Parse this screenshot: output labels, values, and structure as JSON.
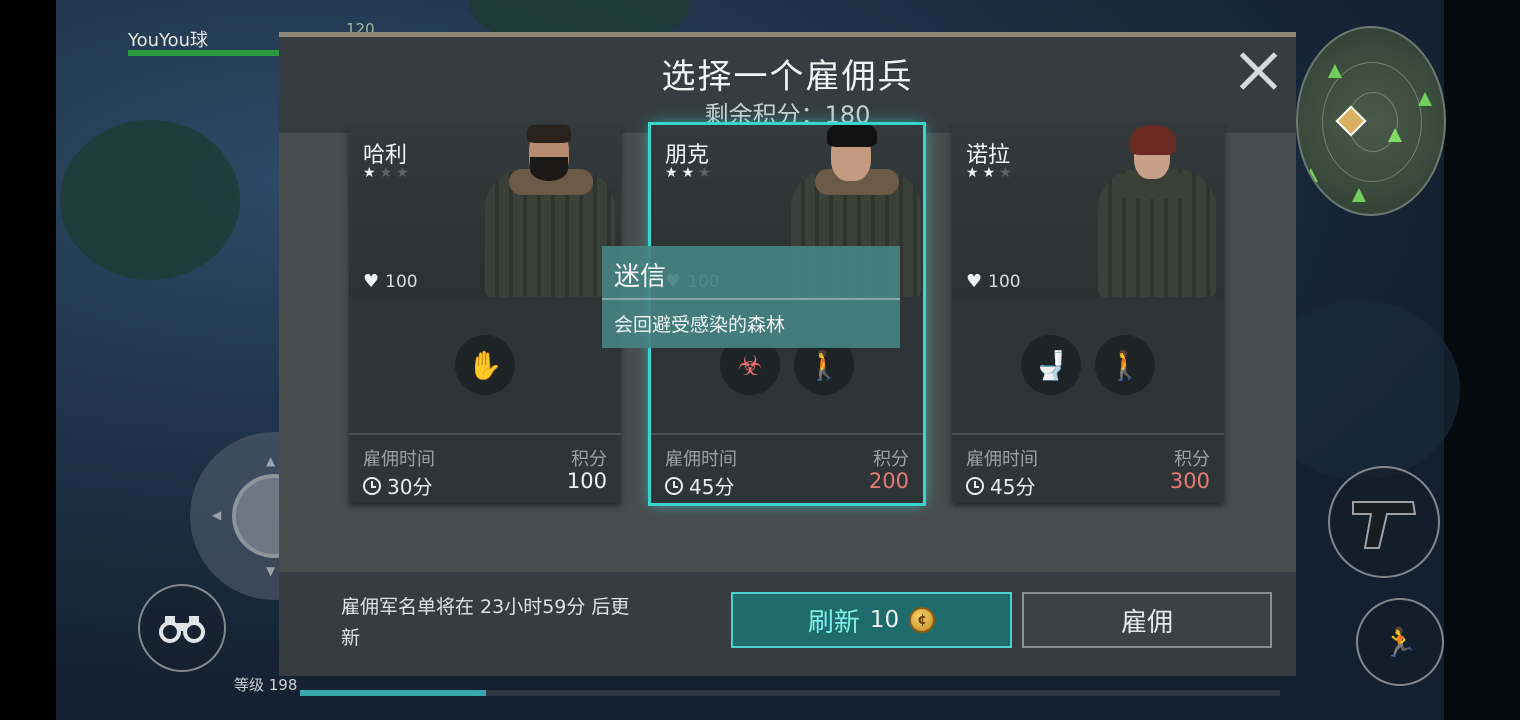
{
  "hud": {
    "player_name": "YouYou球",
    "hp_value": "120",
    "level_label": "等级 198",
    "xp_progress": 0.19
  },
  "modal": {
    "title": "选择一个雇佣兵",
    "points_left": "剩余积分：180",
    "notice": "雇佣军名单将在 23小时59分 后更新",
    "refresh_label": "刷新",
    "refresh_cost": "10",
    "coin_symbol": "¢",
    "hire_label": "雇佣",
    "time_label": "雇佣时间",
    "points_label": "积分"
  },
  "cards": [
    {
      "name": "哈利",
      "stars": 1,
      "hp": "100",
      "traits": [
        {
          "icon": "grab-hand-icon",
          "glyph": "✋",
          "color": "green"
        }
      ],
      "time": "30分",
      "cost": "100",
      "affordable": true,
      "selected": false
    },
    {
      "name": "朋克",
      "stars": 2,
      "hp": "100",
      "traits": [
        {
          "icon": "infected-head-icon",
          "glyph": "☣",
          "color": "red"
        },
        {
          "icon": "walking-person-icon",
          "glyph": "🚶",
          "color": "green"
        }
      ],
      "time": "45分",
      "cost": "200",
      "affordable": false,
      "selected": true
    },
    {
      "name": "诺拉",
      "stars": 2,
      "hp": "100",
      "traits": [
        {
          "icon": "toilet-icon",
          "glyph": "🚽",
          "color": "red"
        },
        {
          "icon": "walking-person-icon",
          "glyph": "🚶",
          "color": "green"
        }
      ],
      "time": "45分",
      "cost": "300",
      "affordable": false,
      "selected": false
    }
  ],
  "tooltip": {
    "title": "迷信",
    "description": "会回避受感染的森林"
  },
  "colors": {
    "accent": "#38d6cf",
    "cost_unaffordable": "#e77a74",
    "trait_good": "#3fbf5c",
    "trait_bad": "#e8706e"
  }
}
